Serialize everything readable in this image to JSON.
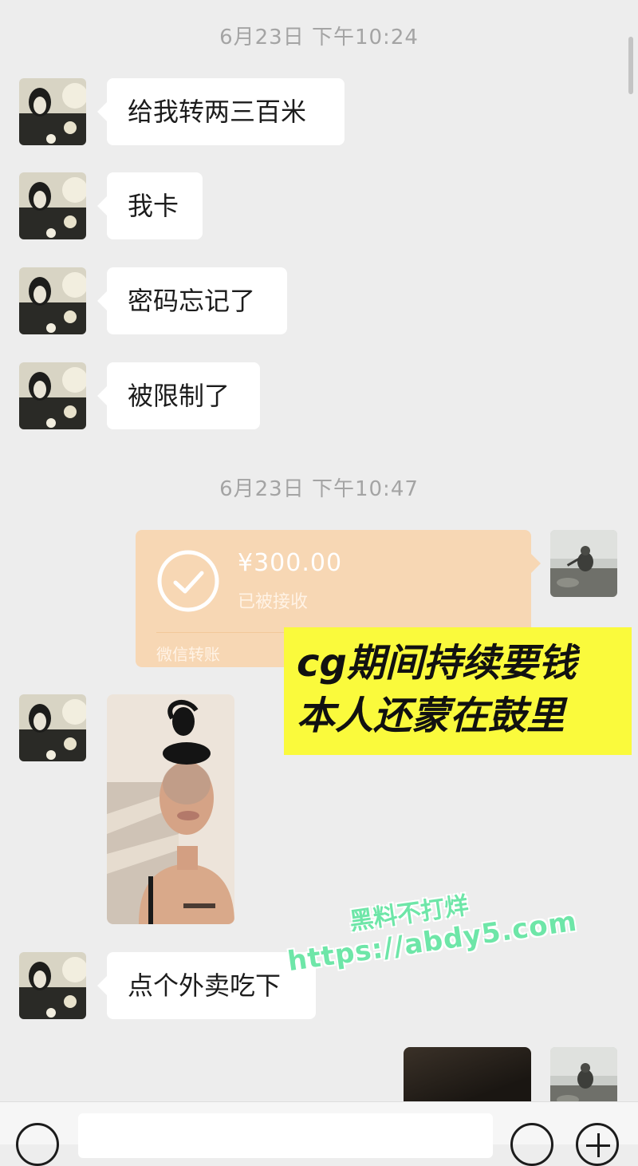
{
  "chat": {
    "timestamps": [
      "6月23日 下午10:24",
      "6月23日 下午10:47"
    ],
    "messages": [
      {
        "sender": "contact",
        "type": "text",
        "text": "给我转两三百米"
      },
      {
        "sender": "contact",
        "type": "text",
        "text": "我卡"
      },
      {
        "sender": "contact",
        "type": "text",
        "text": "密码忘记了"
      },
      {
        "sender": "contact",
        "type": "text",
        "text": "被限制了"
      },
      {
        "sender": "self",
        "type": "transfer",
        "amount": "¥300.00",
        "status": "已被接收",
        "label": "微信转账"
      },
      {
        "sender": "contact",
        "type": "photo",
        "icon": "selfie-photo"
      },
      {
        "sender": "contact",
        "type": "text",
        "text": "点个外卖吃下"
      },
      {
        "sender": "self",
        "type": "photo",
        "icon": "dark-photo"
      }
    ]
  },
  "overlay": {
    "caption_lines": [
      "cg期间持续要钱",
      "本人还蒙在鼓里"
    ],
    "caption_color": "#fafa3c"
  },
  "watermark": {
    "line1": "黑料不打烊",
    "line2": "https://abdy5.com",
    "color": "#6ee6a8"
  },
  "input_bar": {
    "placeholder": "",
    "icons": [
      "voice-icon",
      "emoji-icon",
      "plus-icon"
    ]
  },
  "colors": {
    "background": "#ededed",
    "bubble": "#ffffff",
    "transfer": "#f7d7b4"
  }
}
